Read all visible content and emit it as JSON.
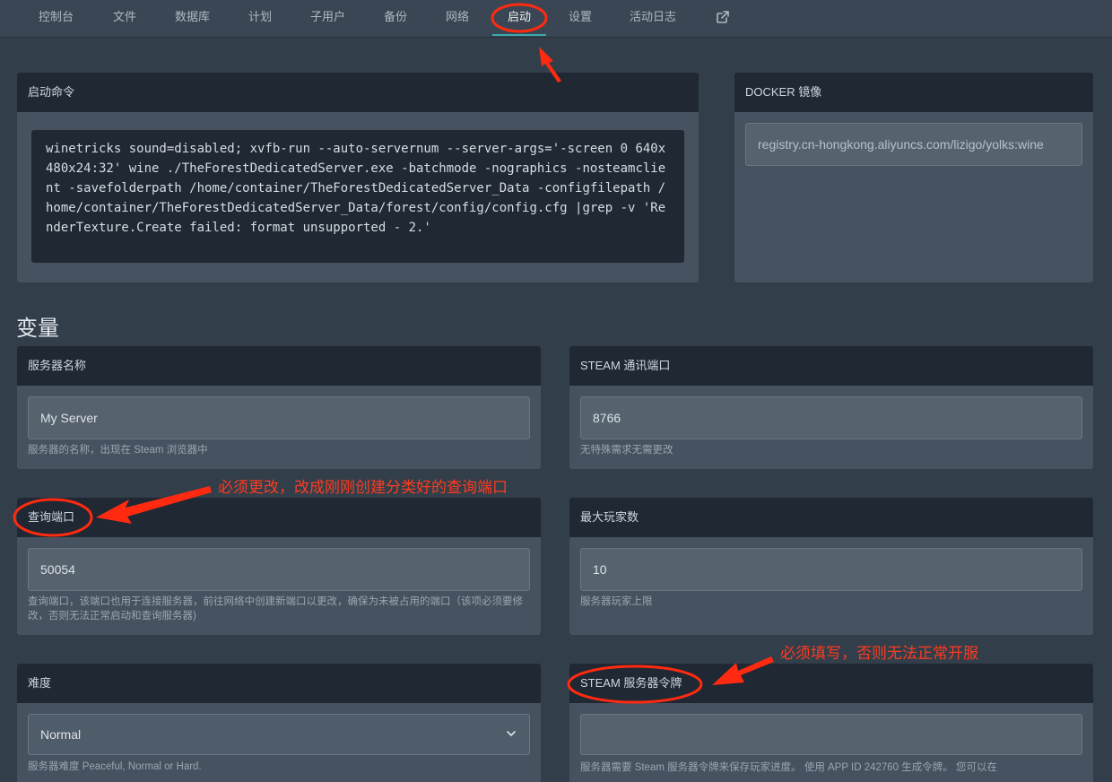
{
  "nav": {
    "items": [
      {
        "label": "控制台"
      },
      {
        "label": "文件"
      },
      {
        "label": "数据库"
      },
      {
        "label": "计划"
      },
      {
        "label": "子用户"
      },
      {
        "label": "备份"
      },
      {
        "label": "网络"
      },
      {
        "label": "启动"
      },
      {
        "label": "设置"
      },
      {
        "label": "活动日志"
      }
    ],
    "active": "启动",
    "external_icon": "external-link-icon"
  },
  "startup": {
    "title": "启动命令",
    "command": "winetricks sound=disabled; xvfb-run --auto-servernum --server-args='-screen 0 640x480x24:32' wine ./TheForestDedicatedServer.exe -batchmode -nographics -nosteamclient -savefolderpath /home/container/TheForestDedicatedServer_Data -configfilepath /home/container/TheForestDedicatedServer_Data/forest/config/config.cfg |grep -v 'RenderTexture.Create failed: format unsupported - 2.'"
  },
  "docker": {
    "title": "DOCKER 镜像",
    "value": "registry.cn-hongkong.aliyuncs.com/lizigo/yolks:wine"
  },
  "variables": {
    "title": "变量",
    "server_name": {
      "label": "服务器名称",
      "value": "My Server",
      "help": "服务器的名称，出现在 Steam 浏览器中"
    },
    "steam_port": {
      "label": "STEAM 通讯端口",
      "value": "8766",
      "help": "无特殊需求无需更改"
    },
    "query_port": {
      "label": "查询端口",
      "value": "50054",
      "help": "查询端口，该端口也用于连接服务器，前往网络中创建新端口以更改，确保为未被占用的端口（该项必须要修改，否则无法正常启动和查询服务器)"
    },
    "max_players": {
      "label": "最大玩家数",
      "value": "10",
      "help": "服务器玩家上限"
    },
    "difficulty": {
      "label": "难度",
      "value": "Normal",
      "help": "服务器难度 Peaceful, Normal or Hard."
    },
    "steam_token": {
      "label": "STEAM 服务器令牌",
      "value": "",
      "help": "服务器需要 Steam 服务器令牌来保存玩家进度。 使用 APP ID 242760 生成令牌。 您可以在"
    }
  },
  "annotations": {
    "query_port_note": "必须更改，改成刚刚创建分类好的查询端口",
    "token_note": "必须填写，否则无法正常开服"
  },
  "colors": {
    "accent": "#3aa9ae",
    "annotation": "#ff3b1f",
    "page_bg": "#323e4a",
    "header_bg": "#1f2833"
  }
}
